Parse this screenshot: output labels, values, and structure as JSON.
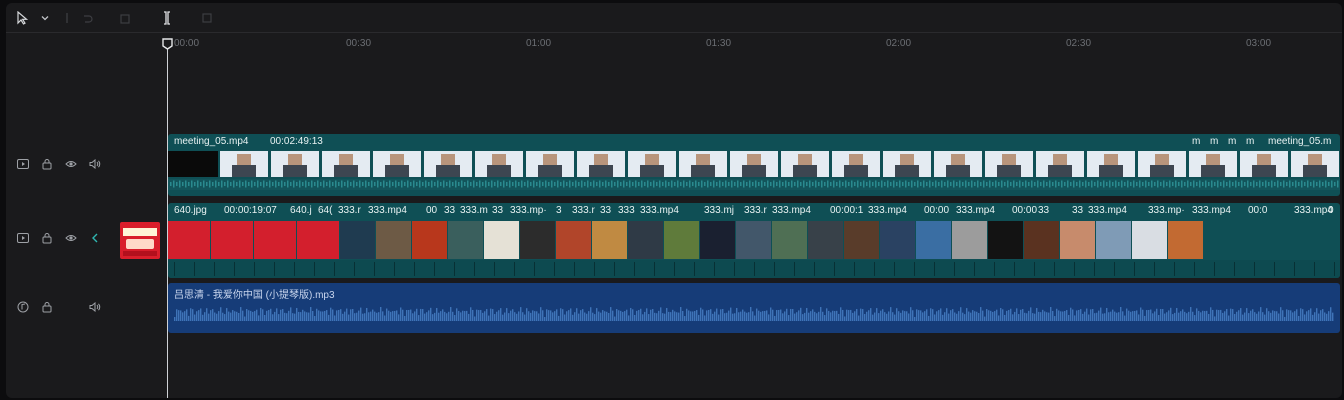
{
  "toolbar": {
    "tools": [
      "select-cursor",
      "dropdown",
      "split",
      "undo",
      "delete",
      "trim",
      "crop"
    ]
  },
  "ruler": {
    "labels": [
      "00:00",
      "00:30",
      "01:00",
      "01:30",
      "02:00",
      "02:30",
      "03:00"
    ]
  },
  "tracks": {
    "main_video": {
      "clip_name": "meeting_05.mp4",
      "clip_duration": "00:02:49:13",
      "tail_labels": [
        "m",
        "m",
        "m",
        "m"
      ],
      "tail_name": "meeting_05.m"
    },
    "overlay_video": {
      "clips": [
        {
          "label": "640.jpg"
        },
        {
          "label": "00:00:19:07"
        },
        {
          "label": "640.j"
        },
        {
          "label": "64("
        },
        {
          "label": "333.r"
        },
        {
          "label": "333.mp4"
        },
        {
          "label": "00"
        },
        {
          "label": "33"
        },
        {
          "label": "333.m"
        },
        {
          "label": "33"
        },
        {
          "label": "333.mp·"
        },
        {
          "label": "3"
        },
        {
          "label": "333.r"
        },
        {
          "label": "33"
        },
        {
          "label": "333"
        },
        {
          "label": "333.mp4"
        },
        {
          "label": "333.mj"
        },
        {
          "label": "333.r"
        },
        {
          "label": "333.mp4"
        },
        {
          "label": "00:00:1"
        },
        {
          "label": "333.mp4"
        },
        {
          "label": "00:00"
        },
        {
          "label": "333.mp4"
        },
        {
          "label": "00:00"
        },
        {
          "label": "33"
        },
        {
          "label": "33"
        },
        {
          "label": "333.mp4"
        },
        {
          "label": "333.mp·"
        },
        {
          "label": "333.mp4"
        },
        {
          "label": "00:0"
        },
        {
          "label": "333.mp4"
        },
        {
          "label": "0"
        }
      ]
    },
    "audio": {
      "clip_name": "吕思清 - 我爱你中国 (小提琴版).mp3"
    }
  },
  "colors": {
    "accent_teal": "#0f5a5f",
    "audio_blue": "#163c78",
    "background": "#1a1a1c"
  }
}
